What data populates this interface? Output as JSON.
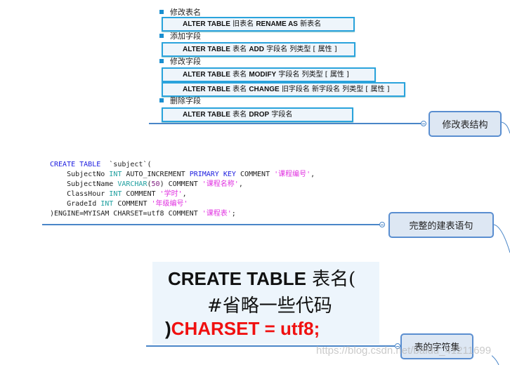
{
  "alter_section": {
    "node_label": "修改表结构",
    "items": [
      {
        "label": "修改表名",
        "statements": [
          [
            "ALTER TABLE",
            " 旧表名 ",
            "RENAME AS",
            " 新表名"
          ]
        ]
      },
      {
        "label": "添加字段",
        "statements": [
          [
            "ALTER TABLE",
            " 表名  ",
            "ADD",
            " 字段名  列类型 [ 属性 ]"
          ]
        ]
      },
      {
        "label": "修改字段",
        "statements": [
          [
            "ALTER TABLE",
            " 表名  ",
            "MODIFY",
            " 字段名  列类型 [ 属性 ]"
          ],
          [
            "ALTER TABLE",
            " 表名  ",
            "CHANGE",
            " 旧字段名 新字段名  列类型 [ 属性 ]"
          ]
        ]
      },
      {
        "label": "删除字段",
        "statements": [
          [
            "ALTER TABLE",
            " 表名  ",
            "DROP",
            "  字段名"
          ]
        ]
      }
    ]
  },
  "create_section": {
    "node_label": "完整的建表语句",
    "code_lines": [
      [
        [
          "kw",
          "CREATE TABLE"
        ],
        [
          "",
          "  `subject`("
        ]
      ],
      [
        [
          "",
          "    SubjectNo "
        ],
        [
          "ty",
          "INT"
        ],
        [
          "",
          " AUTO_INCREMENT "
        ],
        [
          "kw",
          "PRIMARY KEY"
        ],
        [
          "",
          " COMMENT "
        ],
        [
          "st",
          "'课程编号'"
        ],
        [
          "",
          ","
        ]
      ],
      [
        [
          "",
          "    SubjectName "
        ],
        [
          "ty",
          "VARCHAR"
        ],
        [
          "",
          "("
        ],
        [
          "nm",
          "50"
        ],
        [
          "",
          ") COMMENT "
        ],
        [
          "st",
          "'课程名称'"
        ],
        [
          "",
          ","
        ]
      ],
      [
        [
          "",
          "    ClassHour "
        ],
        [
          "ty",
          "INT"
        ],
        [
          "",
          " COMMENT "
        ],
        [
          "st",
          "'学时'"
        ],
        [
          "",
          ","
        ]
      ],
      [
        [
          "",
          "    GradeId "
        ],
        [
          "ty",
          "INT"
        ],
        [
          "",
          " COMMENT "
        ],
        [
          "st",
          "'年级编号'"
        ]
      ],
      [
        [
          "",
          ")ENGINE=MYISAM CHARSET=utf8 COMMENT "
        ],
        [
          "st",
          "'课程表'"
        ],
        [
          "",
          ";"
        ]
      ]
    ]
  },
  "charset_section": {
    "node_label": "表的字符集",
    "line1_keyword": "CREATE TABLE",
    "line1_rest": "  表名(",
    "line2": "#省略一些代码",
    "line3_paren": ")",
    "line3_red": "CHARSET  =  utf8;",
    "highlight_color": "#f01010"
  },
  "watermark": "https://blog.csdn.net/baidu_41211699",
  "colors": {
    "accent": "#2aa3dc",
    "node_border": "#5a8ed0",
    "node_bg": "#dde7f3"
  }
}
